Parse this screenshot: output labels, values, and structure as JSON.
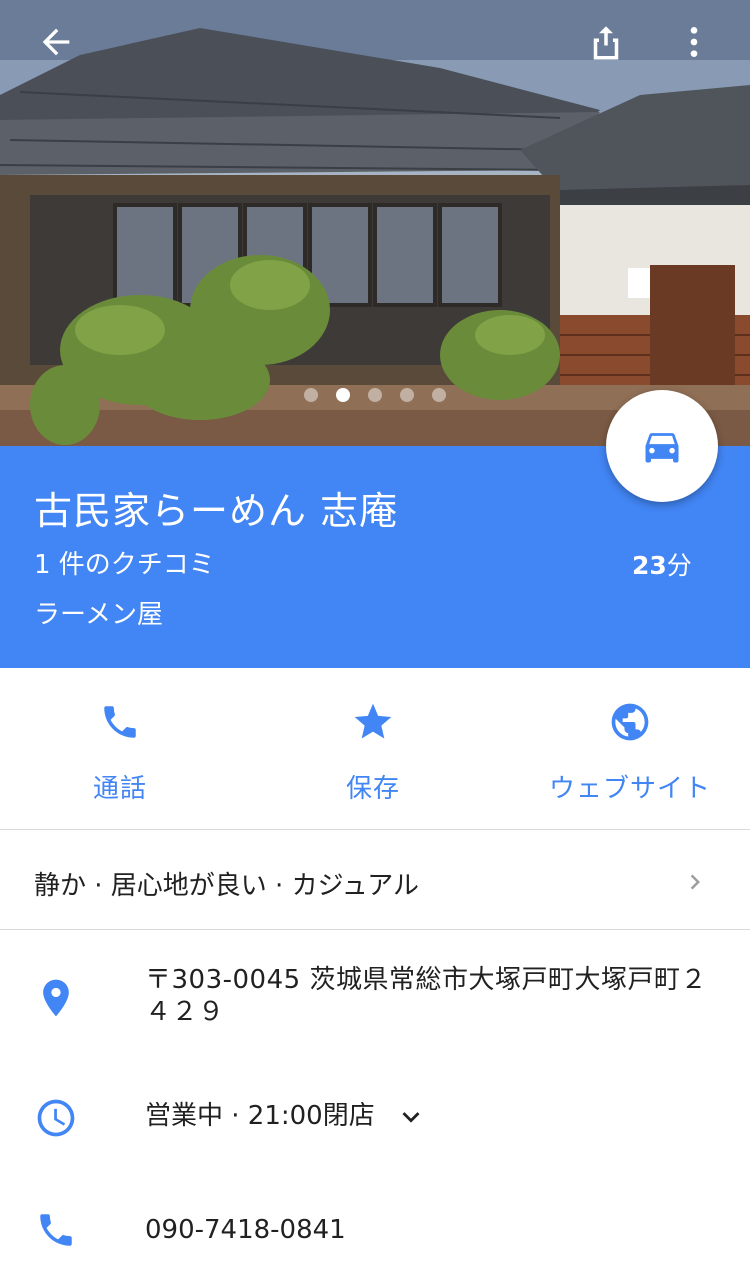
{
  "topbar": {
    "back_icon": "arrow-back-icon",
    "share_icon": "share-icon",
    "more_icon": "more-vert-icon"
  },
  "photo": {
    "carousel_total": 5,
    "carousel_active_index": 1
  },
  "place": {
    "name": "古民家らーめん 志庵",
    "reviews": "1 件のクチコミ",
    "category": "ラーメン屋",
    "drive_time_value": "23",
    "drive_time_unit": "分",
    "fab_icon": "car-icon"
  },
  "actions": [
    {
      "label": "通話",
      "icon": "phone-icon"
    },
    {
      "label": "保存",
      "icon": "star-icon"
    },
    {
      "label": "ウェブサイト",
      "icon": "globe-icon"
    }
  ],
  "attributes": {
    "text": "静か · 居心地が良い · カジュアル",
    "chevron_icon": "chevron-right-icon"
  },
  "info": {
    "address_line1": "〒303-0045 茨城県常総市大塚戸町大塚戸町２",
    "address_line2": "４２９",
    "hours": "営業中 · 21:00閉店",
    "phone": "090-7418-0841"
  },
  "colors": {
    "brand_blue": "#4285f4",
    "icon_blue": "#4285f4",
    "divider": "#dadada"
  }
}
